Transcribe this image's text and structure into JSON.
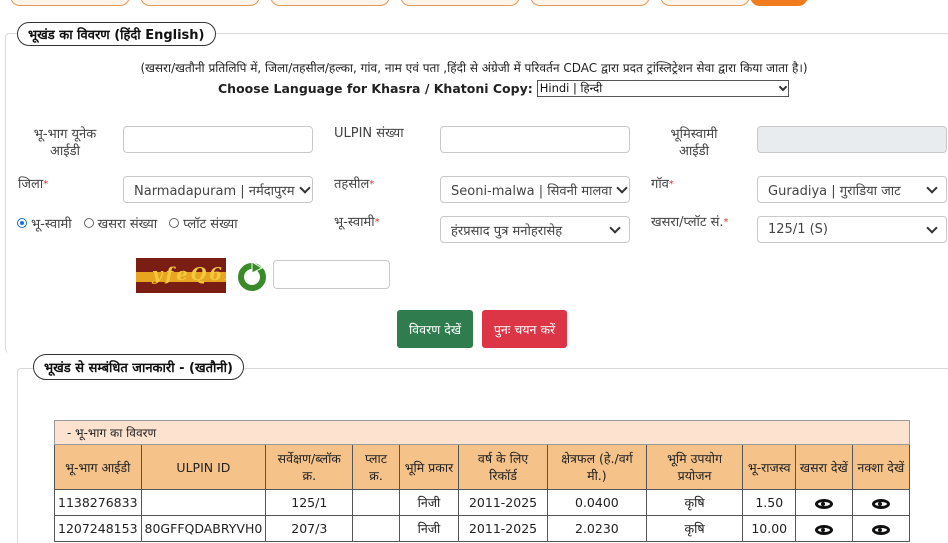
{
  "section1": {
    "legend": "भूखंड का विवरण  (हिंदी  English)",
    "note": "(खसरा/खतौनी प्रतिलिपि में, जिला/तहसील/हल्का, गांव, नाम एवं पता ,हिंदी से अंग्रेजी में परिवर्तन CDAC द्वारा प्रदत ट्रांस्लिट्रेशन सेवा द्वारा किया जाता है।)",
    "language_label": "Choose Language for Khasra / Khatoni Copy:",
    "language_value": "Hindi | हिन्दी"
  },
  "form": {
    "unique_id_label": "भू-भाग  यूनेक आईडी",
    "ulpin_label": "ULPIN संख्या",
    "owner_id_label": "भूमिस्वामी आईडी",
    "district_label": "जिला",
    "district_value": "Narmadapuram | नर्मदापुरम",
    "tehsil_label": "तहसील",
    "tehsil_value": "Seoni-malwa | सिवनी मालवा",
    "village_label": "गॉव",
    "village_value": "Guradiya | गुराडिया जाट",
    "radio_owner": "भू-स्वामी",
    "radio_khasra": "खसरा संख्या",
    "radio_plot": "प्लॉट संख्या",
    "owner_label": "भू-स्वामी",
    "owner_value": "हंरप्रसाद पुत्र मनोहरासेह",
    "khasra_label": "खसरा/प्लॉट सं.",
    "khasra_value": "125/1 (S)",
    "required_mark": "*",
    "captcha_text": "yfeQ6F"
  },
  "buttons": {
    "view": "विवरण देखें",
    "reset": "पुनः चयन करें"
  },
  "section2": {
    "legend": "भूखंड से सम्बंधित जानकारी -   (खतौनी)"
  },
  "table": {
    "caption": "- भू-भाग का विवरण",
    "headers": [
      "भू-भाग आईडी",
      "ULPIN ID",
      "सर्वेक्षण/ब्लॉक क्र.",
      "प्लाट क्र.",
      "भूमि प्रकार",
      "वर्ष के लिए रिकॉर्ड",
      "क्षेत्रफल (हे./वर्ग मी.)",
      "भूमि उपयोग प्रयोजन",
      "भू-राजस्व",
      "खसरा देखें",
      "नक्शा देखें"
    ],
    "rows": [
      [
        "1138276833",
        "",
        "125/1",
        "",
        "निजी",
        "2011-2025",
        "0.0400",
        "कृषि",
        "1.50"
      ],
      [
        "1207248153",
        "80GFFQDABRYVH0",
        "207/3",
        "",
        "निजी",
        "2011-2025",
        "2.0230",
        "कृषि",
        "10.00"
      ]
    ]
  }
}
